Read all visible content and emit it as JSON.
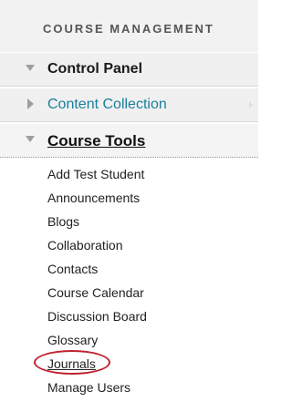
{
  "panel": {
    "title": "COURSE MANAGEMENT"
  },
  "sections": {
    "control_panel": {
      "label": "Control Panel",
      "expanded": true
    },
    "content_collection": {
      "label": "Content Collection",
      "expanded": false
    },
    "course_tools": {
      "label": "Course Tools",
      "expanded": true
    }
  },
  "course_tools": {
    "items": [
      "Add Test Student",
      "Announcements",
      "Blogs",
      "Collaboration",
      "Contacts",
      "Course Calendar",
      "Discussion Board",
      "Glossary",
      "Journals",
      "Manage Users"
    ],
    "highlighted_item": "Journals"
  },
  "colors": {
    "link_teal": "#1a7f9c",
    "highlight_red": "#c0232e",
    "header_bg": "#f2f2f2"
  },
  "icons": {
    "expanded": "chevron-down-icon",
    "collapsed": "chevron-right-icon"
  }
}
